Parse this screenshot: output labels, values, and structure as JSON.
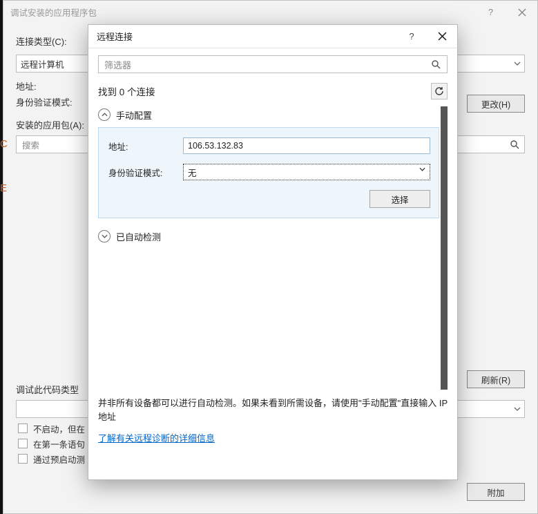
{
  "parent": {
    "title": "调试安装的应用程序包",
    "connection_type_label": "连接类型(C):",
    "connection_type_value": "远程计算机",
    "address_label": "地址:",
    "auth_mode_label": "身份验证模式:",
    "change_button": "更改(H)",
    "installed_packages_label": "安装的应用包(A):",
    "search_placeholder": "搜索",
    "refresh_button": "刷新(R)",
    "debug_code_type_label": "调试此代码类型",
    "cb1": "不启动，但在",
    "cb2": "在第一条语句",
    "cb3": "通过预启动测",
    "attach_button": "附加"
  },
  "modal": {
    "title": "远程连接",
    "filter_placeholder": "筛选器",
    "found_text": "找到 0 个连接",
    "manual_header": "手动配置",
    "address_label": "地址:",
    "address_value": "106.53.132.83",
    "auth_label": "身份验证模式:",
    "auth_value": "无",
    "select_button": "选择",
    "auto_header": "已自动检测",
    "hint_text": "并非所有设备都可以进行自动检测。如果未看到所需设备，请使用\"手动配置\"直接输入 IP 地址",
    "link_text": "了解有关远程诊断的详细信息"
  }
}
